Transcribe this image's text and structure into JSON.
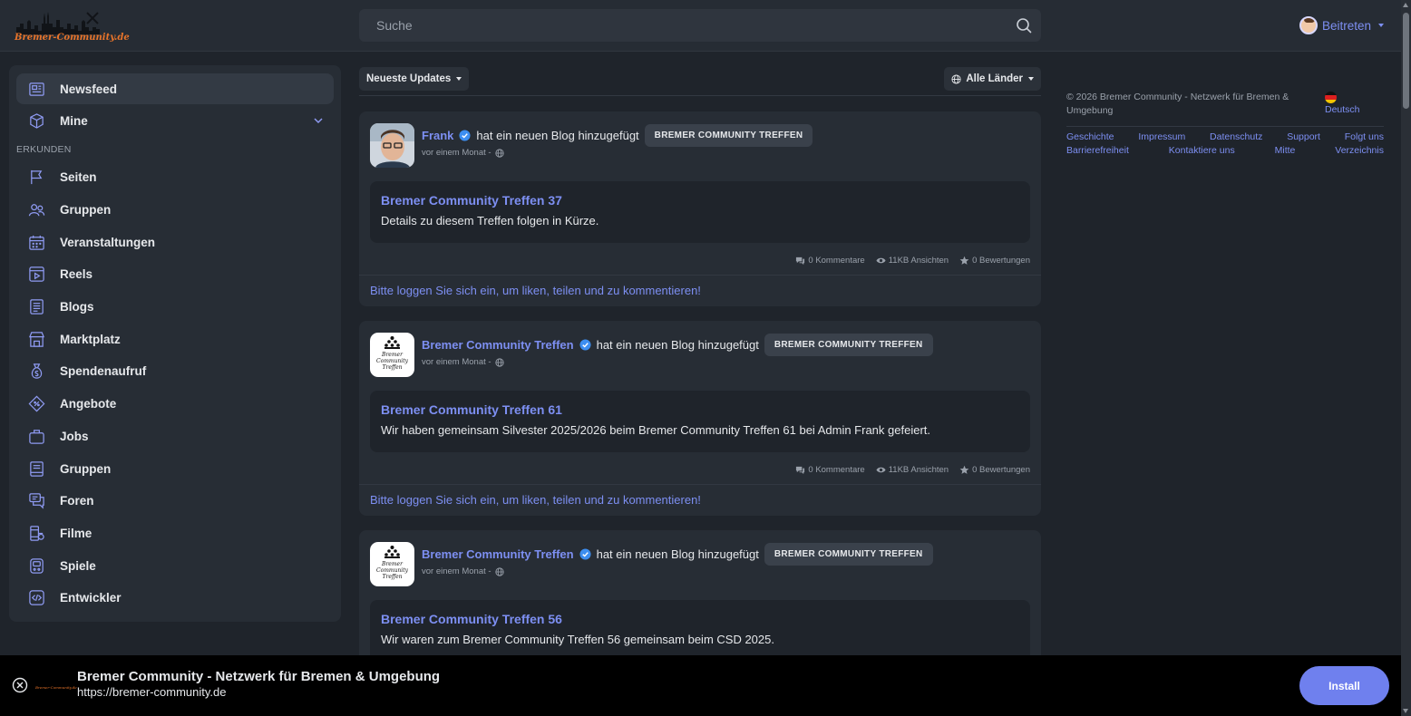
{
  "header": {
    "logo_text": "Bremer-Community.de",
    "search_placeholder": "Suche",
    "join_label": "Beitreten"
  },
  "sidebar": {
    "newsfeed": "Newsfeed",
    "mine": "Mine",
    "section_label": "ERKUNDEN",
    "items": [
      {
        "label": "Seiten",
        "icon": "flag-icon"
      },
      {
        "label": "Gruppen",
        "icon": "users-icon"
      },
      {
        "label": "Veranstaltungen",
        "icon": "calendar-icon"
      },
      {
        "label": "Reels",
        "icon": "video-icon"
      },
      {
        "label": "Blogs",
        "icon": "document-icon"
      },
      {
        "label": "Marktplatz",
        "icon": "store-icon"
      },
      {
        "label": "Spendenaufruf",
        "icon": "money-bag-icon"
      },
      {
        "label": "Angebote",
        "icon": "offer-tag-icon"
      },
      {
        "label": "Jobs",
        "icon": "briefcase-icon"
      },
      {
        "label": "Gruppen",
        "icon": "book-icon"
      },
      {
        "label": "Foren",
        "icon": "forum-icon"
      },
      {
        "label": "Filme",
        "icon": "film-icon"
      },
      {
        "label": "Spiele",
        "icon": "gamepad-icon"
      },
      {
        "label": "Entwickler",
        "icon": "code-icon"
      }
    ]
  },
  "feed": {
    "sort_label": "Neueste Updates",
    "country_label": "Alle Länder",
    "posts": [
      {
        "author": "Frank",
        "action": "hat ein neuen Blog hinzugefügt",
        "badge": "BREMER COMMUNITY TREFFEN",
        "time": "vor einem Monat -",
        "title": "Bremer Community Treffen 37",
        "text": "Details zu diesem Treffen folgen in Kürze.",
        "comments": "0 Kommentare",
        "views": "11KB Ansichten",
        "ratings": "0 Bewertungen",
        "login": "Bitte loggen Sie sich ein, um liken, teilen und zu kommentieren!"
      },
      {
        "author": "Bremer Community Treffen",
        "action": "hat ein neuen Blog hinzugefügt",
        "badge": "BREMER COMMUNITY TREFFEN",
        "time": "vor einem Monat -",
        "title": "Bremer Community Treffen 61",
        "text": "Wir haben gemeinsam Silvester 2025/2026 beim Bremer Community Treffen 61 bei Admin Frank gefeiert.",
        "comments": "0 Kommentare",
        "views": "11KB Ansichten",
        "ratings": "0 Bewertungen",
        "login": "Bitte loggen Sie sich ein, um liken, teilen und zu kommentieren!"
      },
      {
        "author": "Bremer Community Treffen",
        "action": "hat ein neuen Blog hinzugefügt",
        "badge": "BREMER COMMUNITY TREFFEN",
        "time": "vor einem Monat -",
        "title": "Bremer Community Treffen 56",
        "text": "Wir waren zum Bremer Community Treffen 56 gemeinsam beim CSD 2025."
      }
    ]
  },
  "right": {
    "copyright": "© 2026 Bremer Community - Netzwerk für Bremen & Umgebung",
    "language": "Deutsch",
    "links_row1": [
      "Geschichte",
      "Impressum",
      "Datenschutz",
      "Support",
      "Folgt uns"
    ],
    "links_row2": [
      "Barrierefreiheit",
      "Kontaktiere uns",
      "Mitte",
      "Verzeichnis"
    ]
  },
  "install": {
    "mini_logo_text": "Bremer-Community.de",
    "title": "Bremer Community - Netzwerk für Bremen & Umgebung",
    "url": "https://bremer-community.de",
    "button": "Install"
  },
  "colors": {
    "background": "#1f242b",
    "panel": "#272d35",
    "accent": "#7d8ff2",
    "install_button": "#6f80ee"
  }
}
